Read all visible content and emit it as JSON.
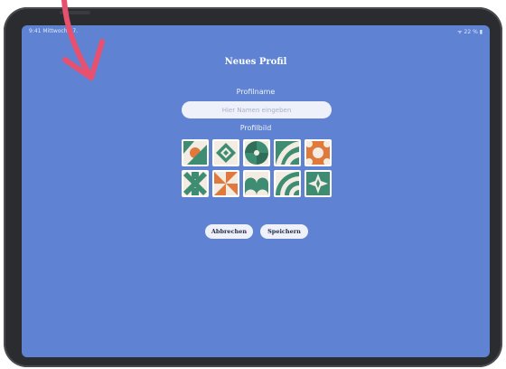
{
  "status": {
    "left": "9:41  Mittwoch 17.",
    "right": "ᯤ 22 % ▮"
  },
  "dialog": {
    "title": "Neues Profil",
    "name_label": "Profilname",
    "name_placeholder": "Hier Namen eingeben",
    "name_value": "",
    "picture_label": "Profilbild"
  },
  "avatars": [
    "avatar-pattern-1",
    "avatar-pattern-2",
    "avatar-pattern-3",
    "avatar-pattern-4",
    "avatar-pattern-5",
    "avatar-pattern-6",
    "avatar-pattern-7",
    "avatar-pattern-8",
    "avatar-pattern-9",
    "avatar-pattern-10"
  ],
  "buttons": {
    "cancel": "Abbrechen",
    "save": "Speichern"
  },
  "colors": {
    "screen_background": "#5f83d2",
    "tile_green": "#3e8c71",
    "tile_orange": "#df7a3c",
    "tile_cream": "#f2ece2",
    "annotation_arrow": "#e8506f"
  }
}
